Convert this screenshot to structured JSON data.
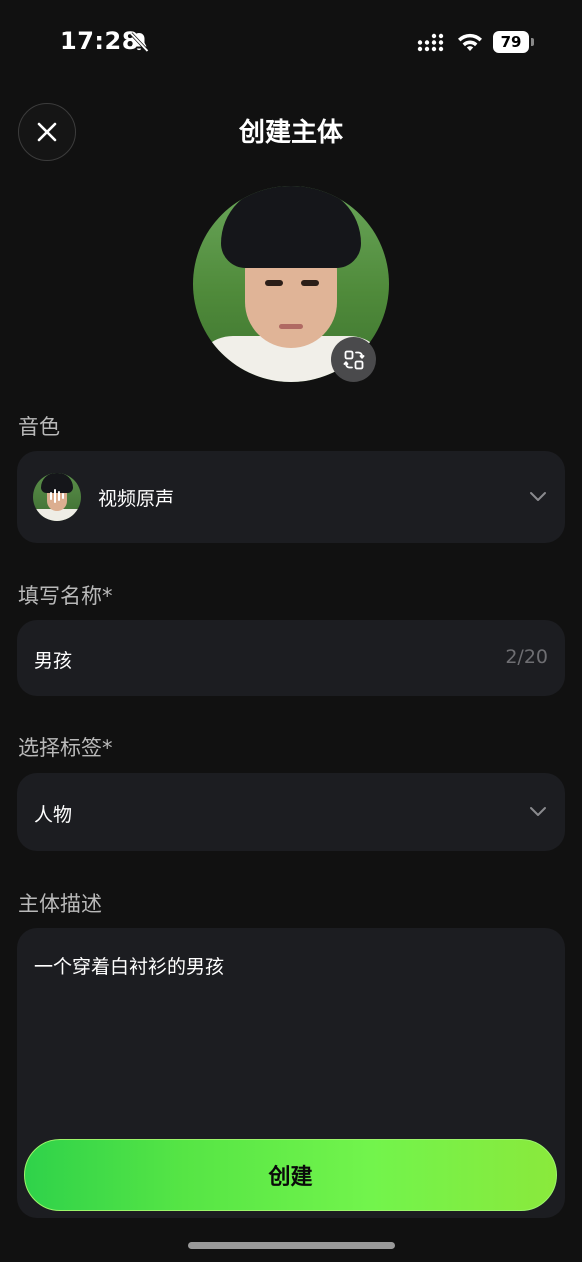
{
  "status_bar": {
    "time": "17:28",
    "battery": "79"
  },
  "header": {
    "title": "创建主体"
  },
  "voice": {
    "label": "音色",
    "value": "视频原声"
  },
  "name": {
    "label": "填写名称*",
    "value": "男孩",
    "counter": "2/20"
  },
  "tag": {
    "label": "选择标签*",
    "value": "人物"
  },
  "description": {
    "label": "主体描述",
    "value": "一个穿着白衬衫的男孩"
  },
  "actions": {
    "create_label": "创建"
  },
  "colors": {
    "background": "#111111",
    "card": "#1c1d21",
    "accent": "#5ee848"
  },
  "icons": [
    "bell-slash-icon",
    "signal-icon",
    "wifi-icon",
    "battery-icon",
    "close-icon",
    "swap-avatar-icon",
    "chevron-down-icon"
  ]
}
